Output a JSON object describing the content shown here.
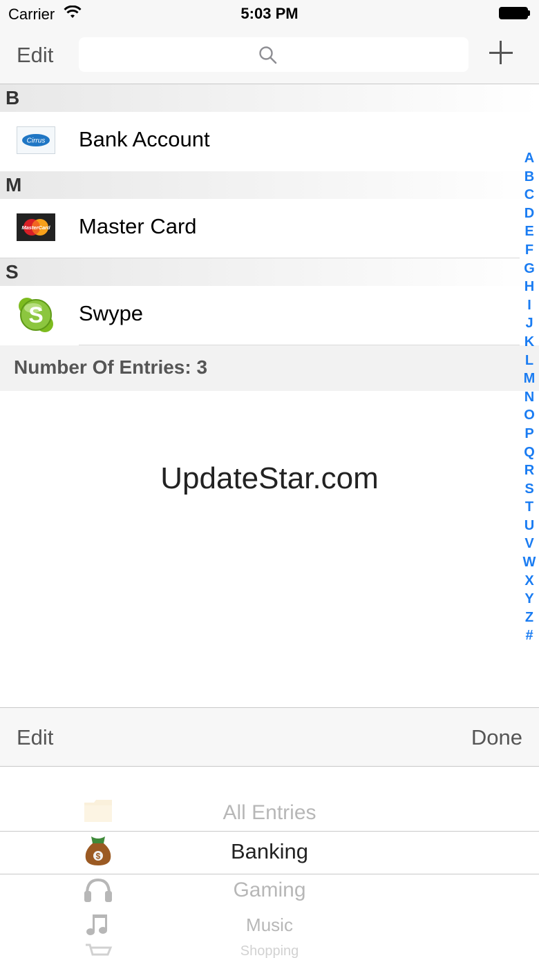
{
  "status_bar": {
    "carrier": "Carrier",
    "time": "5:03 PM"
  },
  "nav": {
    "edit_label": "Edit",
    "search_placeholder": "",
    "add_icon": "plus-icon"
  },
  "sections": [
    {
      "letter": "B",
      "entry": {
        "label": "Bank Account",
        "icon": "cirrus-card-icon"
      }
    },
    {
      "letter": "M",
      "entry": {
        "label": "Master Card",
        "icon": "mastercard-icon"
      }
    },
    {
      "letter": "S",
      "entry": {
        "label": "Swype",
        "icon": "skype-icon"
      }
    }
  ],
  "entries_footer": "Number Of Entries: 3",
  "index_letters": [
    "A",
    "B",
    "C",
    "D",
    "E",
    "F",
    "G",
    "H",
    "I",
    "J",
    "K",
    "L",
    "M",
    "N",
    "O",
    "P",
    "Q",
    "R",
    "S",
    "T",
    "U",
    "V",
    "W",
    "X",
    "Y",
    "Z",
    "#"
  ],
  "watermark": "UpdateStar.com",
  "toolbar": {
    "edit_label": "Edit",
    "done_label": "Done"
  },
  "picker": {
    "items": [
      {
        "label": "All Entries",
        "icon": "folder-icon"
      },
      {
        "label": "Banking",
        "icon": "money-bag-icon"
      },
      {
        "label": "Gaming",
        "icon": "headset-icon"
      },
      {
        "label": "Music",
        "icon": "music-note-icon"
      },
      {
        "label": "Shopping",
        "icon": "shopping-cart-icon"
      }
    ],
    "selected": "Banking"
  },
  "colors": {
    "accent": "#1a7cf2",
    "bar_background": "#f7f7f7"
  }
}
